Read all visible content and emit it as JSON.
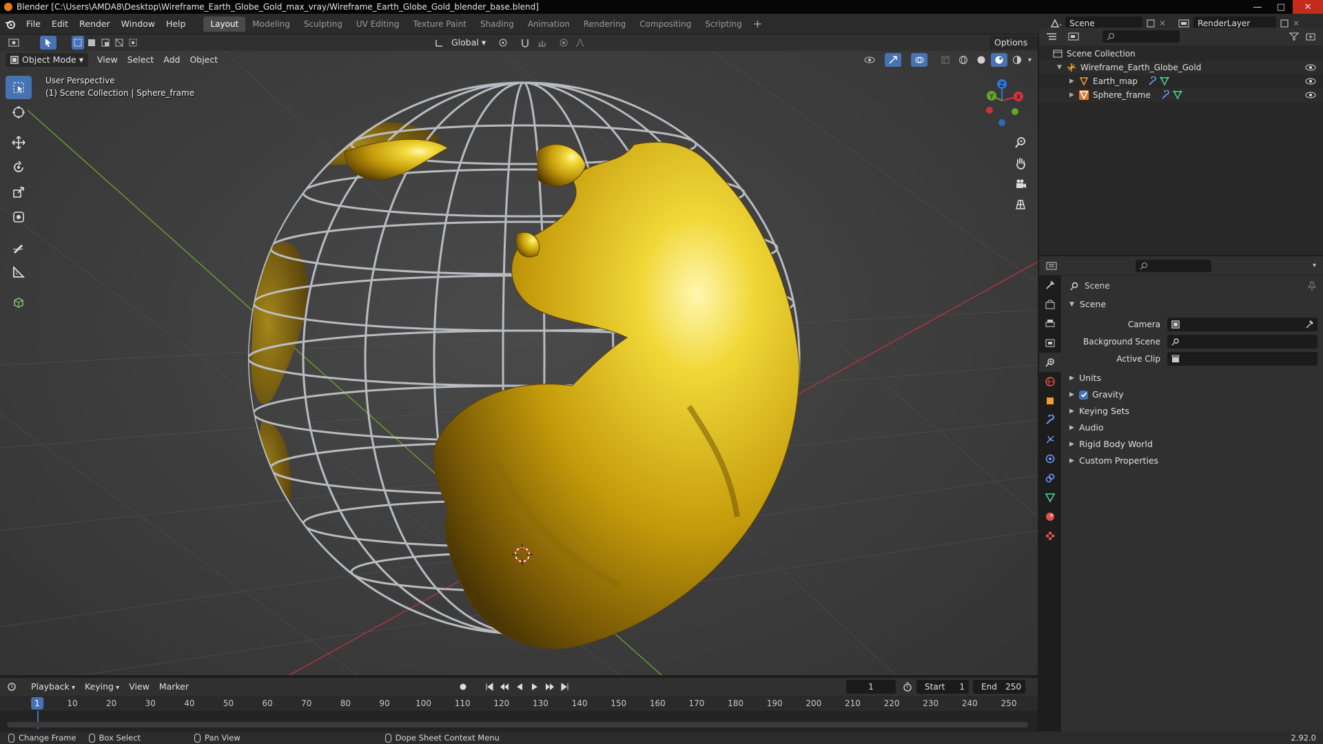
{
  "window": {
    "title": "Blender [C:\\Users\\AMDA8\\Desktop\\Wireframe_Earth_Globe_Gold_max_vray/Wireframe_Earth_Globe_Gold_blender_base.blend]"
  },
  "menu": [
    "File",
    "Edit",
    "Render",
    "Window",
    "Help"
  ],
  "workspaces": [
    "Layout",
    "Modeling",
    "Sculpting",
    "UV Editing",
    "Texture Paint",
    "Shading",
    "Animation",
    "Rendering",
    "Compositing",
    "Scripting"
  ],
  "active_workspace": "Layout",
  "scene_field": "Scene",
  "renderlayer_field": "RenderLayer",
  "tool_header": {
    "transform_orientation": "Global",
    "options_label": "Options"
  },
  "view_header": {
    "mode": "Object Mode",
    "menus": [
      "View",
      "Select",
      "Add",
      "Object"
    ]
  },
  "viewport": {
    "perspective": "User Perspective",
    "context": "(1) Scene Collection | Sphere_frame",
    "gizmo_axes": [
      "Z",
      "Y",
      "X"
    ]
  },
  "outliner": {
    "root": "Scene Collection",
    "items": [
      {
        "label": "Wireframe_Earth_Globe_Gold",
        "level": 1
      },
      {
        "label": "Earth_map",
        "level": 2
      },
      {
        "label": "Sphere_frame",
        "level": 2
      }
    ]
  },
  "properties": {
    "breadcrumb": "Scene",
    "panel_title": "Scene",
    "fields": [
      {
        "label": "Camera"
      },
      {
        "label": "Background Scene"
      },
      {
        "label": "Active Clip"
      }
    ],
    "subpanels": [
      "Units",
      "Gravity",
      "Keying Sets",
      "Audio",
      "Rigid Body World",
      "Custom Properties"
    ],
    "gravity_checked": true
  },
  "timeline": {
    "menus": [
      "Playback",
      "Keying",
      "View",
      "Marker"
    ],
    "current_frame": "1",
    "start_label": "Start",
    "start_value": "1",
    "end_label": "End",
    "end_value": "250",
    "ticks": [
      "1",
      "10",
      "20",
      "30",
      "40",
      "50",
      "60",
      "70",
      "80",
      "90",
      "100",
      "110",
      "120",
      "130",
      "140",
      "150",
      "160",
      "170",
      "180",
      "190",
      "200",
      "210",
      "220",
      "230",
      "240",
      "250"
    ]
  },
  "statusbar": {
    "items": [
      "Change Frame",
      "Box Select",
      "Pan View",
      "Dope Sheet Context Menu"
    ],
    "version": "2.92.0"
  }
}
